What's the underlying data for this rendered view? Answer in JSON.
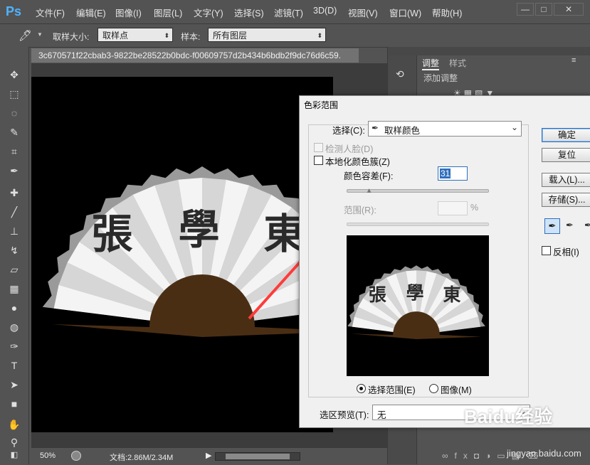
{
  "app": {
    "logo": "Ps"
  },
  "menu": [
    "文件(F)",
    "编辑(E)",
    "图像(I)",
    "图层(L)",
    "文字(Y)",
    "选择(S)",
    "滤镜(T)",
    "3D(D)",
    "视图(V)",
    "窗口(W)",
    "帮助(H)"
  ],
  "window_controls": {
    "minimize": "—",
    "maximize": "□",
    "close": "✕"
  },
  "options": {
    "sample_size_label": "取样大小:",
    "sample_size_value": "取样点",
    "sample_label": "样本:",
    "sample_value": "所有图层"
  },
  "document": {
    "tab_title": "3c670571f22cbab3-9822be28522b0bdc-f00609757d2b434b6bdb2f9dc76d6c59.",
    "zoom": "50%",
    "doc_info": "文档:2.86M/2.34M"
  },
  "fan": {
    "characters": [
      "張",
      "學",
      "東"
    ],
    "rib_count": 18
  },
  "right_panel": {
    "tab_adjust": "调整",
    "tab_style": "样式",
    "add_adjust": "添加调整"
  },
  "dialog": {
    "title": "色彩范围",
    "select_label": "选择(C):",
    "select_value": "取样颜色",
    "detect_faces": "检测人脸(D)",
    "localized_clusters": "本地化颜色簇(Z)",
    "fuzziness_label": "颜色容差(F):",
    "fuzziness_value": "31",
    "range_label": "范围(R):",
    "range_unit": "%",
    "radio_selection": "选择范围(E)",
    "radio_image": "图像(M)",
    "preview_label": "选区预览(T):",
    "preview_value": "无",
    "btn_ok": "确定",
    "btn_reset": "复位",
    "btn_load": "载入(L)...",
    "btn_save": "存储(S)...",
    "invert_label": "反相(I)",
    "fuzziness_slider_fraction": 0.16
  },
  "watermark": {
    "text": "Baidu经验",
    "url": "jingyan.baidu.com"
  },
  "colors": {
    "arrow": "#ff3b3b",
    "ps_blue": "#4fb3ff",
    "fan_handle": "#4a2e14"
  }
}
